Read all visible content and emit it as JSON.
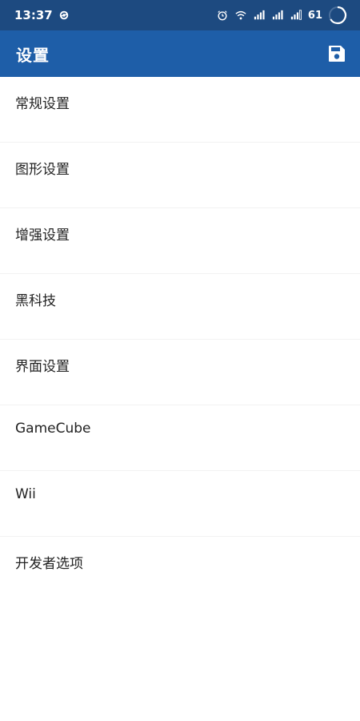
{
  "status_bar": {
    "time": "13:37",
    "battery_level": "61",
    "icons": [
      "sync-icon",
      "alarm-icon",
      "wifi-icon",
      "signal-icon",
      "signal-icon",
      "hd-signal-icon",
      "battery-ring-icon"
    ]
  },
  "app_bar": {
    "title": "设置",
    "save_icon": "save-icon"
  },
  "settings": {
    "items": [
      {
        "label": "常规设置"
      },
      {
        "label": "图形设置"
      },
      {
        "label": "增强设置"
      },
      {
        "label": "黑科技"
      },
      {
        "label": "界面设置"
      },
      {
        "label": "GameCube"
      },
      {
        "label": "Wii"
      },
      {
        "label": "开发者选项"
      }
    ]
  },
  "colors": {
    "status_bar": "#1d4a80",
    "app_bar": "#1e5ea8",
    "text": "#222222",
    "background": "#ffffff"
  }
}
